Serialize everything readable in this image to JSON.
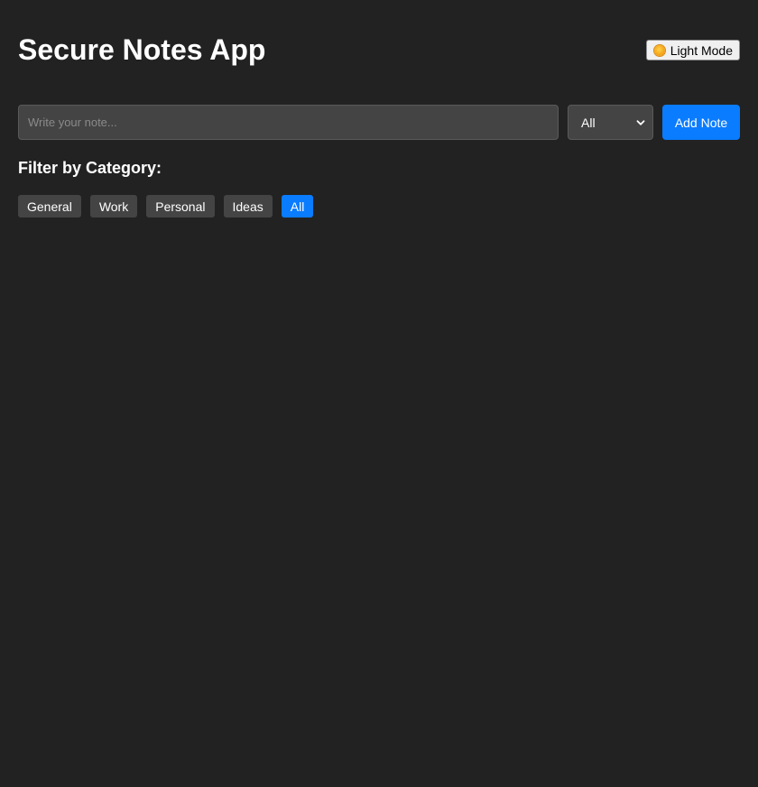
{
  "app": {
    "title": "Secure Notes App",
    "theme_toggle_label": "Light Mode",
    "theme_toggle_icon": "sun-icon"
  },
  "composer": {
    "placeholder": "Write your note...",
    "value": "",
    "category_selected": "All",
    "add_button_label": "Add Note"
  },
  "filter": {
    "heading": "Filter by Category:",
    "chips": [
      {
        "label": "General",
        "active": false
      },
      {
        "label": "Work",
        "active": false
      },
      {
        "label": "Personal",
        "active": false
      },
      {
        "label": "Ideas",
        "active": false
      },
      {
        "label": "All",
        "active": true
      }
    ]
  },
  "colors": {
    "background": "#222222",
    "surface": "#444444",
    "accent": "#0a7cff",
    "text": "#ffffff"
  }
}
